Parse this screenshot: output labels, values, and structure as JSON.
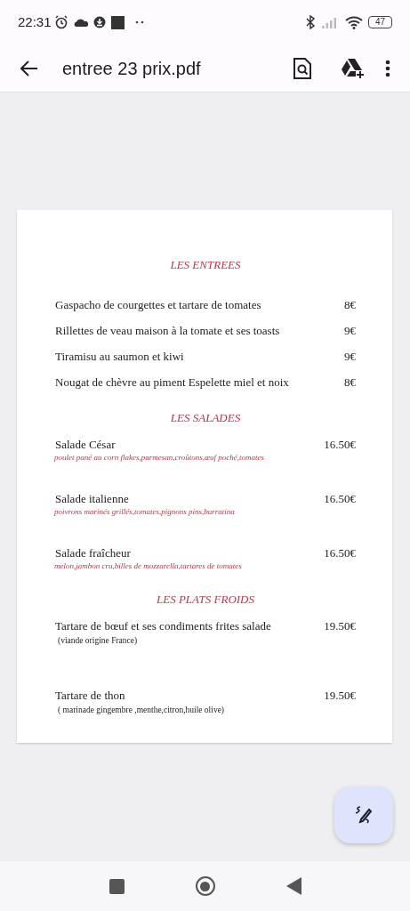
{
  "status_bar": {
    "time": "22:31",
    "battery": "47"
  },
  "app_bar": {
    "title": "entree 23 prix.pdf"
  },
  "document": {
    "sections": [
      {
        "title": "LES ENTREES",
        "items": [
          {
            "name": "Gaspacho de courgettes et tartare de tomates",
            "price": "8€"
          },
          {
            "name": "Rillettes de veau maison à la tomate et ses toasts",
            "price": "9€"
          },
          {
            "name": "Tiramisu au saumon et kiwi",
            "price": "9€"
          },
          {
            "name": "Nougat de chèvre au piment Espelette miel et noix",
            "price": "8€"
          }
        ]
      },
      {
        "title": "LES SALADES",
        "kind": "accent",
        "items": [
          {
            "name": "Salade César",
            "price": "16.50€",
            "note": "poulet pané au corn flakes,parmesan,croûtons,œuf poché,tomates"
          },
          {
            "name": "Salade italienne",
            "price": "16.50€",
            "note": "poivrons marinés grillés,tomates,pignons pins,burratina"
          },
          {
            "name": "Salade fraîcheur",
            "price": "16.50€",
            "note": "melon,jambon cru,billes de mozzarella,tartares de tomates"
          }
        ]
      },
      {
        "title": "LES PLATS FROIDS",
        "kind": "plain",
        "items": [
          {
            "name": "Tartare de bœuf et ses condiments frites salade",
            "price": "19.50€",
            "note": "(viande origine France)"
          },
          {
            "name": "Tartare de thon",
            "price": "19.50€",
            "note": "( marinade gingembre ,menthe,citron,huile olive)"
          }
        ]
      }
    ]
  }
}
